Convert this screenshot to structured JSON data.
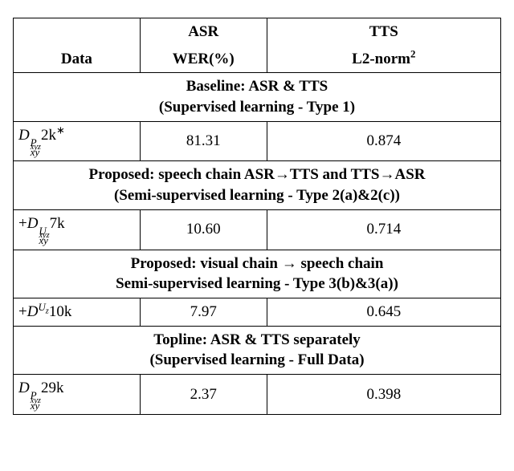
{
  "chart_data": {
    "type": "table",
    "columns": [
      "Data",
      "ASR WER(%)",
      "TTS L2-norm²"
    ],
    "sections": [
      {
        "title": "Baseline: ASR & TTS (Supervised learning - Type 1)",
        "rows": [
          [
            "D_xy^{P_xyz} 2k*",
            81.31,
            0.874
          ]
        ]
      },
      {
        "title": "Proposed: speech chain ASR→TTS and TTS→ASR (Semi-supervised learning - Type 2(a)&2(c))",
        "rows": [
          [
            "+D_xy^{U_xyz} 7k",
            10.6,
            0.714
          ]
        ]
      },
      {
        "title": "Proposed: visual chain → speech chain Semi-supervised learning - Type 3(b)&3(a))",
        "rows": [
          [
            "+D^{U_z} 10k",
            7.97,
            0.645
          ]
        ]
      },
      {
        "title": "Topline: ASR & TTS separately (Supervised learning - Full Data)",
        "rows": [
          [
            "D_xy^{P_xyz} 29k",
            2.37,
            0.398
          ]
        ]
      }
    ]
  },
  "header": {
    "data_label": "Data",
    "asr_line1": "ASR",
    "asr_line2": "WER(%)",
    "tts_line1": "TTS",
    "tts_line2_prefix": "L2-norm",
    "tts_line2_sup": "2"
  },
  "sections": [
    {
      "line1": "Baseline: ASR & TTS",
      "line2": "(Supervised learning - Type 1)",
      "rows": [
        {
          "data_html": "<span class=\"math-it\">D</span><span class=\"supsub\"><span><span class=\"math-it\">P</span><sub style=\"font-size:0.8em\"><span class=\"math-it\">xyz</span></sub></span><span><span class=\"math-it\">xy</span></span></span>2k<sup>∗</sup>",
          "asr": "81.31",
          "tts": "0.874"
        }
      ]
    },
    {
      "line1": "Proposed: speech chain ASR→TTS and TTS→ASR",
      "line2": "(Semi-supervised learning - Type 2(a)&2(c))",
      "rows": [
        {
          "data_html": "+<span class=\"math-it\">D</span><span class=\"supsub\"><span><span class=\"math-it\">U</span><sub style=\"font-size:0.8em\"><span class=\"math-it\">xyz</span></sub></span><span><span class=\"math-it\">xy</span></span></span>7k",
          "asr": "10.60",
          "tts": "0.714"
        }
      ]
    },
    {
      "line1": "Proposed: visual chain → speech chain",
      "line2": "Semi-supervised learning - Type 3(b)&3(a))",
      "rows": [
        {
          "data_html": "+<span class=\"math-it\">D</span><sup><span class=\"math-it\">U</span><sub style=\"font-size:0.8em\"><span class=\"math-it\">z</span></sub></sup>10k",
          "asr": "7.97",
          "tts": "0.645"
        }
      ]
    },
    {
      "line1": "Topline: ASR & TTS separately",
      "line2": "(Supervised learning - Full Data)",
      "rows": [
        {
          "data_html": "<span class=\"math-it\">D</span><span class=\"supsub\"><span><span class=\"math-it\">P</span><sub style=\"font-size:0.8em\"><span class=\"math-it\">xyz</span></sub></span><span><span class=\"math-it\">xy</span></span></span>29k",
          "asr": "2.37",
          "tts": "0.398"
        }
      ]
    }
  ]
}
